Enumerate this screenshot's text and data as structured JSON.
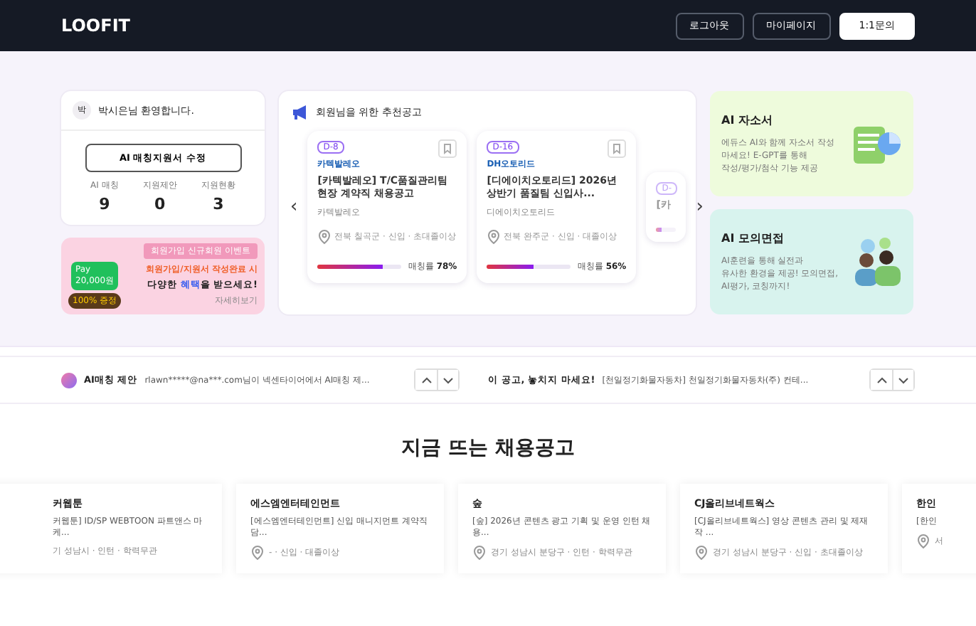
{
  "header": {
    "logo": "LOOFIT",
    "buttons": [
      {
        "label": "로그아웃",
        "kind": "outline"
      },
      {
        "label": "마이페이지",
        "kind": "outline"
      },
      {
        "label": "1:1문의",
        "kind": "solid"
      }
    ]
  },
  "welcome": {
    "avatar": "박",
    "greeting": "박시은님 환영합니다.",
    "button": "AI 매칭지원서 수정",
    "stats": [
      {
        "label": "AI 매칭",
        "value": "9"
      },
      {
        "label": "지원제안",
        "value": "0"
      },
      {
        "label": "지원현황",
        "value": "3"
      }
    ]
  },
  "banner": {
    "tag": "회원가입 신규회원 이벤트",
    "pay": "Pay",
    "amount": "20,000원",
    "coin": "100% 증정",
    "line1": "회원가입/지원서 작성완료 시",
    "line2": "다양한 **혜택**을 받으세요!",
    "link": "자세히보기"
  },
  "recommend": {
    "title": "회원님을 위한 추천공고",
    "prev": "‹",
    "next": "›",
    "cards": [
      {
        "dday": "D-8",
        "logo": "카텍발레오",
        "title": "[카텍발레오] T/C품질관리팀 현장 계약직 채용공고",
        "company": "카텍발레오",
        "meta": "전북 칠곡군 · 신입 · 초대졸이상",
        "match_label": "매칭률",
        "match": "78%",
        "level": 0.78,
        "faded": false
      },
      {
        "dday": "D-16",
        "logo": "DH오토리드",
        "title": "[디에이치오토리드] 2026년 상반기 품질팀 신입사...",
        "company": "디에이치오토리드",
        "meta": "전북 완주군 · 신입 · 대졸이상",
        "match_label": "매칭률",
        "match": "56%",
        "level": 0.56,
        "faded": false
      },
      {
        "dday": "D-",
        "title": "[카",
        "level": 0.3,
        "faded": true
      }
    ]
  },
  "ai_cards": [
    {
      "title": "AI 자소서",
      "desc": "에듀스 AI와 함께 자소서 작성\n마세요! E-GPT를 통해\n작성/평가/첨삭 기능 제공",
      "kind": "document",
      "color": "#eefbdc"
    },
    {
      "title": "AI 모의면접",
      "desc": "AI훈련을 통해 실전과\n유사한 환경을 제공! 모의면접,\nAI평가, 코칭까지!",
      "kind": "interview",
      "color": "#d8f3ee"
    }
  ],
  "ticker": [
    {
      "label": "AI매칭 제안",
      "text": "rlawn*****@na***.com님이 넥센타이어에서 AI매칭 제...",
      "kind": "ai"
    },
    {
      "label": "이 공고, 놓치지 마세요!",
      "text": "[천일정기화물자동차] 천일정기화물자동차(주) 컨테...",
      "kind": "plain"
    }
  ],
  "hot_jobs": {
    "title": "지금 뜨는 채용공고",
    "cards": [
      {
        "company": "커웹툰",
        "title": "커웹툰] ID/SP WEBTOON 파트앤스 마케...",
        "meta": "기 성남시 · 인턴 · 학력무관",
        "pin": false
      },
      {
        "company": "에스엠엔터테인먼트",
        "title": "[에스엠엔터테인먼트] 신입 매니지먼트 계약직 담...",
        "meta": "- · 신입 · 대졸이상",
        "pin": true
      },
      {
        "company": "숲",
        "title": "[숲] 2026년 콘텐츠 광고 기획 및 운영 인턴 채용...",
        "meta": "경기 성남시 분당구 · 인턴 · 학력무관",
        "pin": true
      },
      {
        "company": "CJ올리브네트웍스",
        "title": "[CJ올리브네트웍스] 영상 콘텐츠 관리 및 제재작 ...",
        "meta": "경기 성남시 분당구 · 신입 · 초대졸이상",
        "pin": true
      },
      {
        "company": "한인",
        "title": "[한인",
        "meta": "서",
        "pin": true
      }
    ]
  }
}
